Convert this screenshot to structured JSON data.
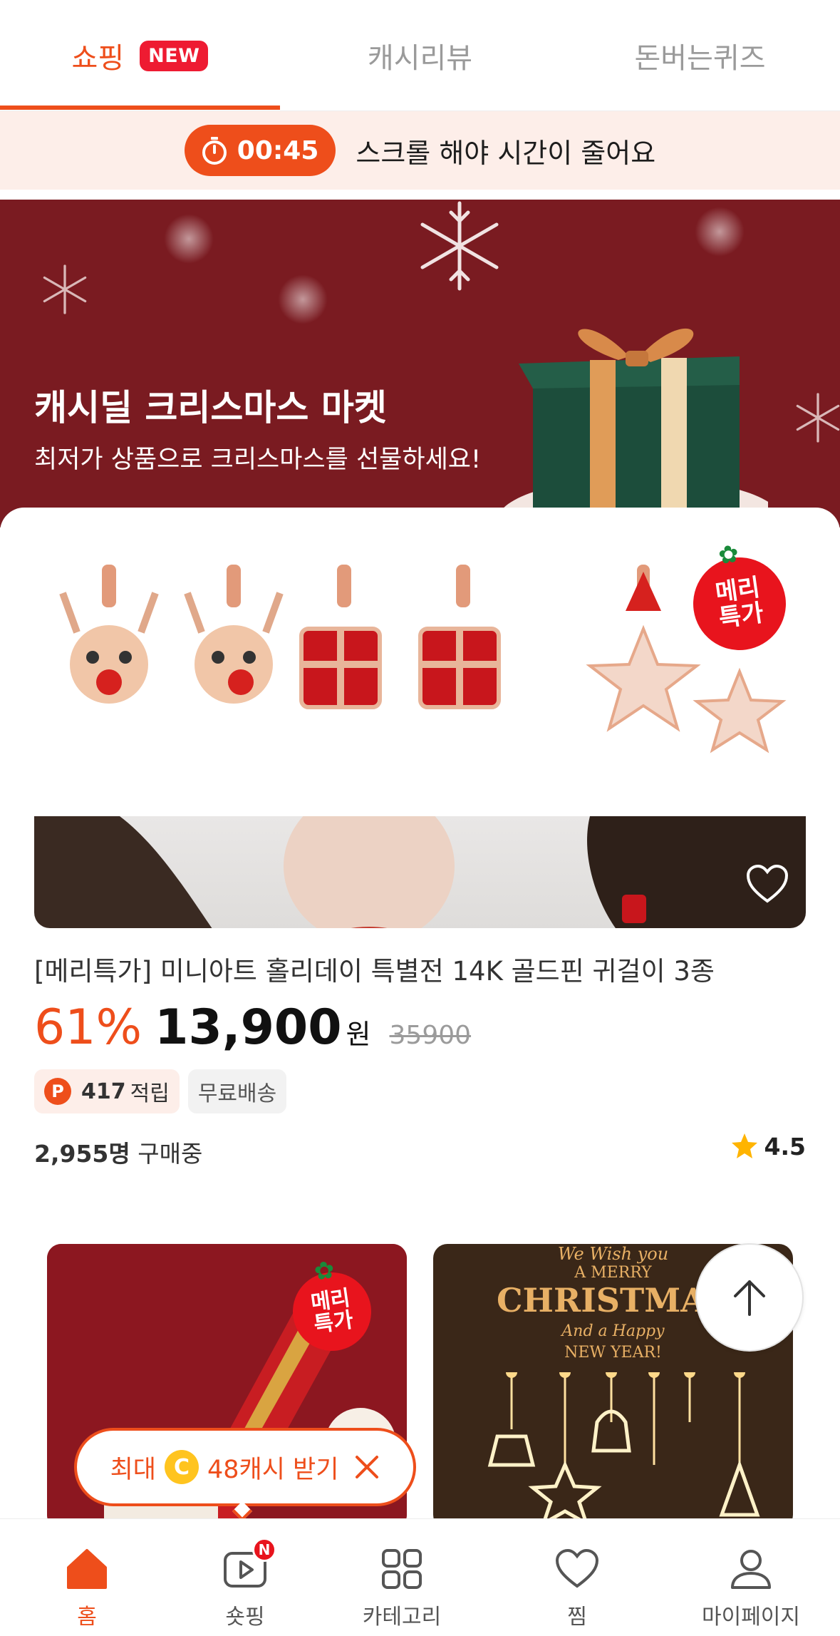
{
  "tabs": [
    {
      "label": "쇼핑",
      "badge": "NEW"
    },
    {
      "label": "캐시리뷰"
    },
    {
      "label": "돈버는퀴즈"
    }
  ],
  "timer": {
    "time": "00:45",
    "message": "스크롤 해야 시간이 줄어요"
  },
  "banner": {
    "title": "캐시딜 크리스마스 마켓",
    "subtitle": "최저가 상품으로 크리스마스를 선물하세요!"
  },
  "product": {
    "merry_badge_line1": "메리",
    "merry_badge_line2": "특가",
    "title": "[메리특가] 미니아트 홀리데이 특별전 14K 골드핀 귀걸이 3종",
    "discount": "61%",
    "price": "13,900",
    "currency": "원",
    "original_price": "35900",
    "points_icon": "P",
    "points": "417",
    "points_label": "적립",
    "shipping": "무료배송",
    "buyers_count": "2,955명",
    "buyers_label": "구매중",
    "rating": "4.5"
  },
  "grid": {
    "item2_lines": [
      "We Wish you",
      "A MERRY",
      "CHRISTMAS",
      "And a Happy",
      "NEW YEAR!"
    ]
  },
  "cash_bubble": {
    "prefix": "최대",
    "coin": "C",
    "amount": "48캐시 받기"
  },
  "bottom_nav": [
    {
      "label": "홈",
      "icon": "home-icon"
    },
    {
      "label": "숏핑",
      "icon": "play-icon",
      "badge": "N"
    },
    {
      "label": "카테고리",
      "icon": "grid-icon"
    },
    {
      "label": "찜",
      "icon": "heart-icon"
    },
    {
      "label": "마이페이지",
      "icon": "user-icon"
    }
  ],
  "colors": {
    "accent": "#ee4e1b",
    "banner_bg": "#7a1b21",
    "badge_red": "#e8141d"
  }
}
